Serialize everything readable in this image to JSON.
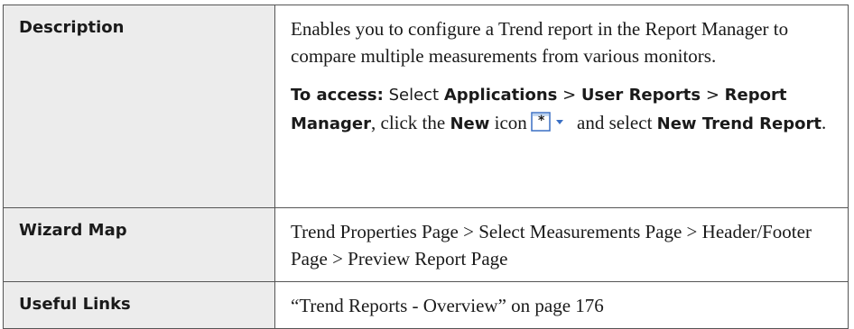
{
  "rows": {
    "description": {
      "label": "Description",
      "text": "Enables you to configure a Trend report in the Report Manager to compare multiple measurements from various monitors.",
      "access": {
        "lead": "To access:",
        "t1": " Select ",
        "applications": "Applications",
        "sep1": " > ",
        "user_reports": "User Reports",
        "sep2": " > ",
        "report_manager": "Report Manager",
        "t2": ", click the ",
        "new": "New",
        "t3": " icon",
        "icon_name": "new-report-dropdown-icon",
        "t4": " and select ",
        "new_trend_report": "New Trend Report",
        "t5": "."
      }
    },
    "wizard_map": {
      "label": "Wizard Map",
      "text": "Trend Properties Page > Select Measurements Page > Header/Footer Page > Preview Report Page"
    },
    "useful_links": {
      "label": "Useful Links",
      "text": "“Trend Reports - Overview” on page 176"
    }
  },
  "colors": {
    "label_background": "#ececec",
    "border": "#555555",
    "icon_blue": "#3a6fc4",
    "icon_star": "#1a1a1a"
  }
}
